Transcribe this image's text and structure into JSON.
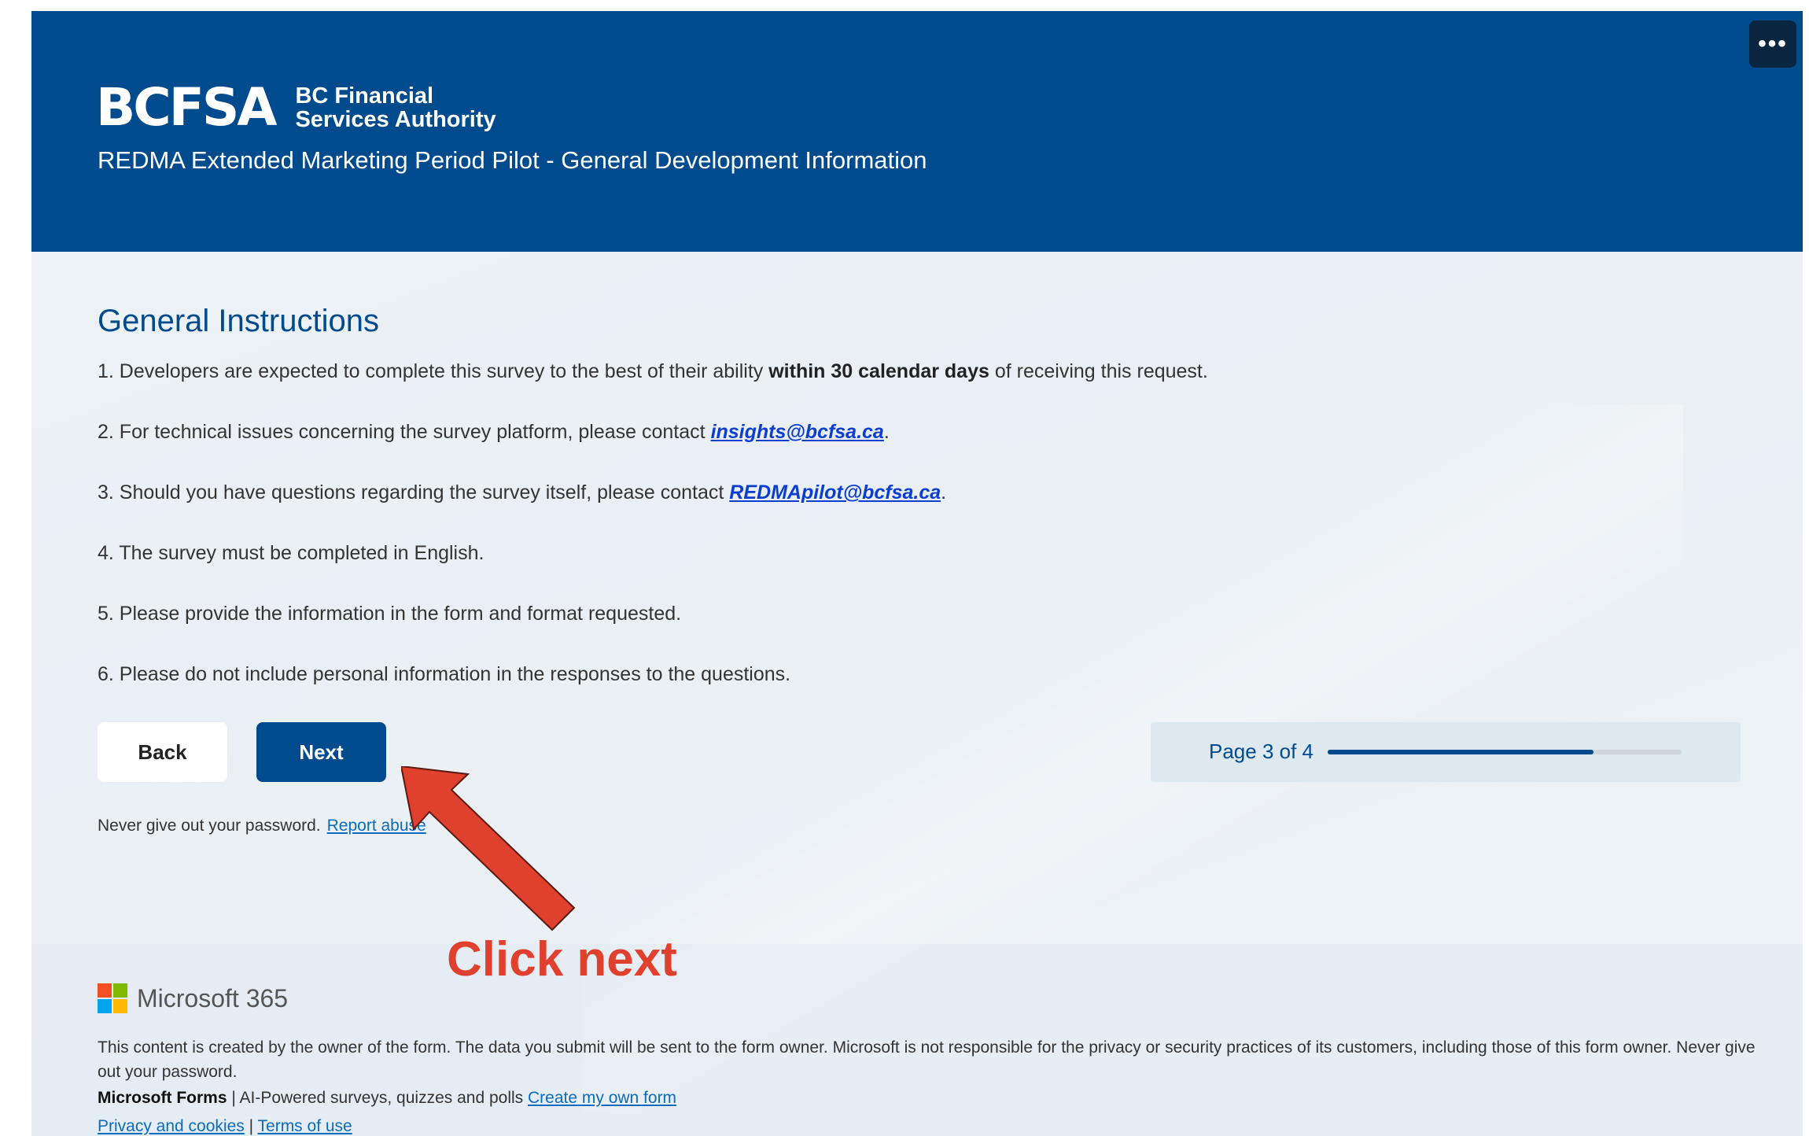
{
  "header": {
    "logo_mark": "BCFSA",
    "logo_line1": "BC Financial",
    "logo_line2": "Services Authority",
    "form_title": "REDMA Extended Marketing Period Pilot - General Development Information",
    "more_button": "•••",
    "background_color": "#004b8d"
  },
  "section": {
    "title": "General Instructions",
    "items": [
      {
        "pre": "1. Developers are expected to complete this survey to the best of their ability ",
        "bold": "within 30 calendar days",
        "post": " of receiving this request."
      },
      {
        "pre": "2. For technical issues concerning the survey platform, please contact ",
        "link": "insights@bcfsa.ca",
        "post": "."
      },
      {
        "pre": "3. Should you have questions regarding the survey itself, please contact ",
        "link": "REDMApilot@bcfsa.ca",
        "post": "."
      },
      {
        "text": "4. The survey must be completed in English."
      },
      {
        "text": "5. Please provide the information in the form and format requested."
      },
      {
        "text": "6. Please do not include personal information in the responses to the questions."
      }
    ]
  },
  "buttons": {
    "back": "Back",
    "next": "Next"
  },
  "progress": {
    "label": "Page 3 of 4",
    "fraction": 0.75
  },
  "warning": {
    "text": "Never give out your password.",
    "link": "Report abuse"
  },
  "annotation": {
    "text": "Click next",
    "color": "#e0402e"
  },
  "footer": {
    "brand": "Microsoft 365",
    "disclaimer": "This content is created by the owner of the form. The data you submit will be sent to the form owner. Microsoft is not responsible for the privacy or security practices of its customers, including those of this form owner. Never give out your password.",
    "product": "Microsoft Forms",
    "tagline": " | AI-Powered surveys, quizzes and polls ",
    "create_link": "Create my own form",
    "privacy_link": "Privacy and cookies",
    "separator": " | ",
    "terms_link": "Terms of use"
  }
}
